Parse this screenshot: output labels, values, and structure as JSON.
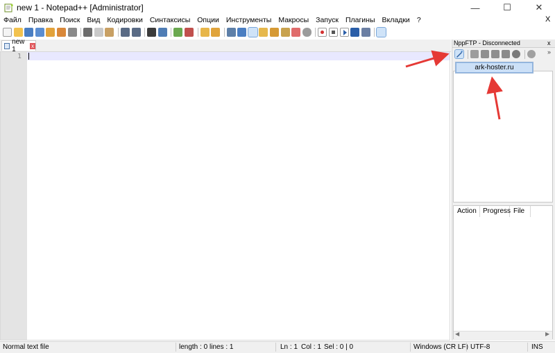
{
  "window": {
    "title": "new 1 - Notepad++ [Administrator]",
    "minimize_glyph": "—",
    "maximize_glyph": "☐",
    "close_glyph": "✕"
  },
  "menu": {
    "items": [
      "Файл",
      "Правка",
      "Поиск",
      "Вид",
      "Кодировки",
      "Синтаксисы",
      "Опции",
      "Инструменты",
      "Макросы",
      "Запуск",
      "Плагины",
      "Вкладки",
      "?"
    ],
    "close_glyph": "X"
  },
  "toolbar": {
    "icons": [
      "new-file-icon",
      "open-file-icon",
      "save-icon",
      "save-all-icon",
      "close-icon",
      "close-all-icon",
      "print-icon",
      "cut-icon",
      "copy-icon",
      "paste-icon",
      "undo-icon",
      "redo-icon",
      "find-icon",
      "replace-icon",
      "zoom-in-icon",
      "zoom-out-icon",
      "sync-vertical-icon",
      "sync-horizontal-icon",
      "word-wrap-icon",
      "all-chars-icon",
      "indent-guide-icon",
      "doc-map-icon",
      "function-list-icon",
      "folder-workspace-icon",
      "doc-switcher-icon",
      "record-macro-icon",
      "stop-record-icon",
      "play-macro-icon",
      "run-macro-multiple-icon",
      "save-macro-icon",
      "nppftp-icon"
    ]
  },
  "tabs": [
    {
      "label": "new 1",
      "close_glyph": "x"
    }
  ],
  "editor": {
    "line_numbers": [
      "1"
    ]
  },
  "nppftp": {
    "title": "NppFTP - Disconnected",
    "close_glyph": "x",
    "more_glyph": "»",
    "toolbar_icons": [
      "connect-icon",
      "disconnect-icon",
      "download-icon",
      "upload-icon",
      "refresh-icon",
      "abort-icon",
      "settings-icon"
    ],
    "profiles": [
      "ark-hoster.ru"
    ],
    "queue_columns": [
      "Action",
      "Progress",
      "File"
    ],
    "scroll_left": "◀",
    "scroll_right": "▶"
  },
  "status": {
    "file_type": "Normal text file",
    "length": "length : 0",
    "lines": "lines : 1",
    "ln": "Ln : 1",
    "col": "Col : 1",
    "sel": "Sel : 0 | 0",
    "eol": "Windows (CR LF)",
    "encoding": "UTF-8",
    "mode": "INS"
  },
  "colors": {
    "accent_arrow": "#e53935",
    "current_line": "#e8e8ff",
    "selection": "#cce0f7"
  }
}
